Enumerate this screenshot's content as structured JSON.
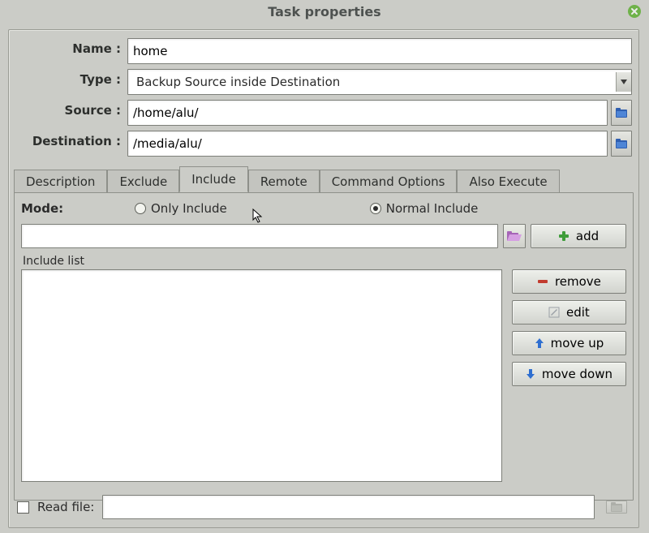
{
  "window": {
    "title": "Task properties"
  },
  "fields": {
    "name_label": "Name :",
    "name_value": "home",
    "type_label": "Type :",
    "type_value": "Backup Source inside Destination",
    "source_label": "Source :",
    "source_value": "/home/alu/",
    "dest_label": "Destination :",
    "dest_value": "/media/alu/"
  },
  "tabs": {
    "description": "Description",
    "exclude": "Exclude",
    "include": "Include",
    "remote": "Remote",
    "command_options": "Command Options",
    "also_execute": "Also Execute",
    "active": "include"
  },
  "include_panel": {
    "mode_label": "Mode:",
    "only_include_label": "Only Include",
    "normal_include_label": "Normal Include",
    "mode_selected": "normal",
    "input_value": "",
    "add_label": "add",
    "list_caption": "Include list",
    "remove_label": "remove",
    "edit_label": "edit",
    "moveup_label": "move up",
    "movedown_label": "move down"
  },
  "readfile": {
    "checked": false,
    "label": "Read file:",
    "value": ""
  }
}
